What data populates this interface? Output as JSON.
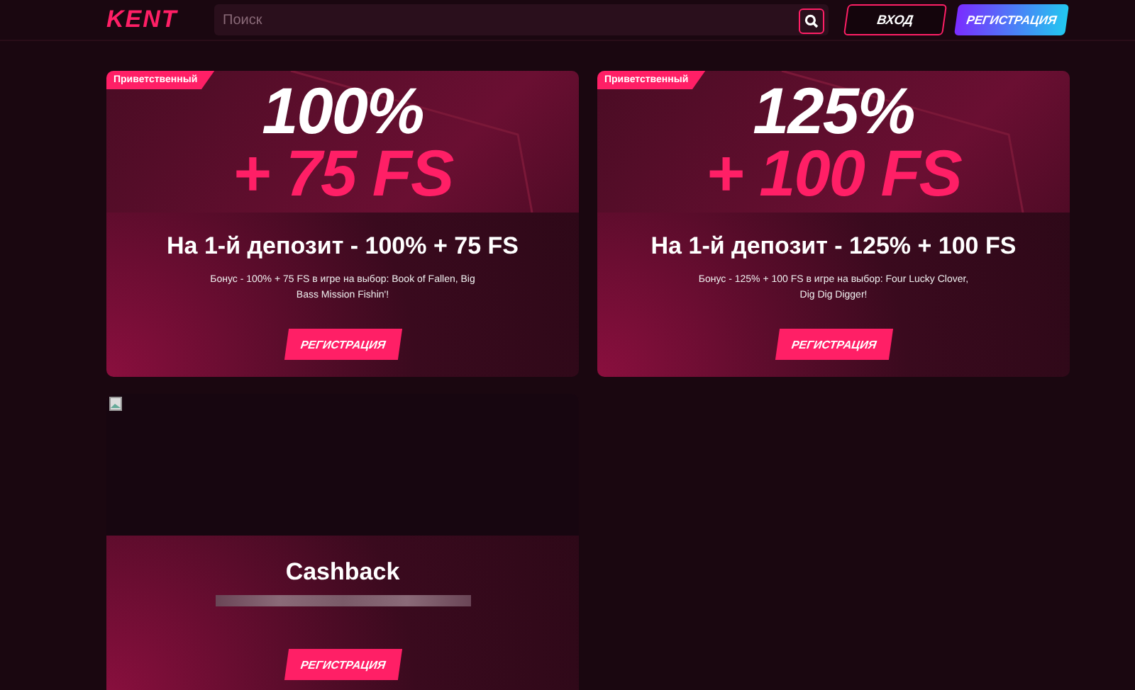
{
  "header": {
    "logo": "KENT",
    "search": {
      "placeholder": "Поиск"
    },
    "buttons": [
      {
        "label": "ВХОД",
        "kind": "outline"
      },
      {
        "label": "РЕГИСТРАЦИЯ",
        "kind": "gradient"
      }
    ]
  },
  "cards": [
    {
      "kind": "promo",
      "badge": "Приветственный",
      "headline": "100%",
      "subline": "+ 75 FS",
      "title": "На 1-й депозит - 100% + 75 FS",
      "description": "Бонус - 100% + 75 FS в игре на выбор: Book of Fallen, Big Bass Mission Fishin'!",
      "button": "РЕГИСТРАЦИЯ"
    },
    {
      "kind": "promo",
      "badge": "Приветственный",
      "headline": "125%",
      "subline": "+ 100 FS",
      "title": "На 1-й депозит - 125% + 100 FS",
      "description": "Бонус - 125% + 100 FS в игре на выбор: Four Lucky Clover, Dig Dig Digger!",
      "button": "РЕГИСТРАЦИЯ"
    },
    {
      "kind": "image",
      "title": "Cashback",
      "button": "РЕГИСТРАЦИЯ"
    }
  ]
}
